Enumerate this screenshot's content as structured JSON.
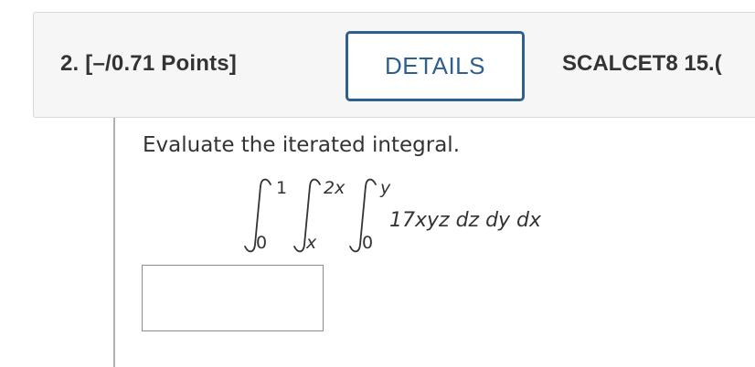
{
  "question": {
    "number_points": "2. [–/0.71 Points]",
    "details_label": "DETAILS",
    "source_label": "SCALCET8 15.("
  },
  "problem": {
    "prompt": "Evaluate the iterated integral.",
    "integral": {
      "outer_upper": "1",
      "outer_lower": "0",
      "middle_upper": "2x",
      "middle_lower": "x",
      "inner_upper": "y",
      "inner_lower": "0",
      "integrand": "17xyz dz dy dx"
    }
  },
  "answer": {
    "value": ""
  }
}
